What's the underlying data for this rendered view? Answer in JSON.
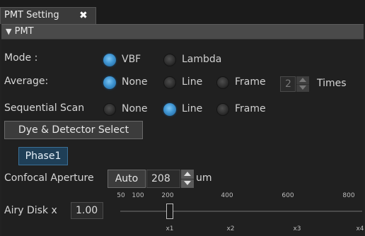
{
  "tab": {
    "title": "PMT Setting",
    "close": "✖"
  },
  "panel": {
    "arrow": "▼",
    "title": "PMT"
  },
  "mode": {
    "label": "Mode :",
    "options": [
      "VBF",
      "Lambda"
    ],
    "selected": "VBF"
  },
  "average": {
    "label": "Average:",
    "options": [
      "None",
      "Line",
      "Frame"
    ],
    "selected": "None",
    "times_value": "2",
    "times_label": "Times"
  },
  "sequential_scan": {
    "label": "Sequential Scan",
    "options": [
      "None",
      "Line",
      "Frame"
    ],
    "selected": "Line"
  },
  "dye_button": "Dye & Detector Select",
  "phase_button": "Phase1",
  "confocal": {
    "label": "Confocal Aperture",
    "auto_label": "Auto",
    "value": "208",
    "unit": "um"
  },
  "airy": {
    "label": "Airy Disk  x",
    "value": "1.00",
    "top_ticks": [
      "50",
      "100",
      "200",
      "400",
      "600",
      "800"
    ],
    "bottom_ticks": [
      "x1",
      "x2",
      "x3",
      "x4"
    ],
    "slider_value": 208
  },
  "colors": {
    "accent": "#3f95d2",
    "phase_bg": "#1f3f57"
  }
}
